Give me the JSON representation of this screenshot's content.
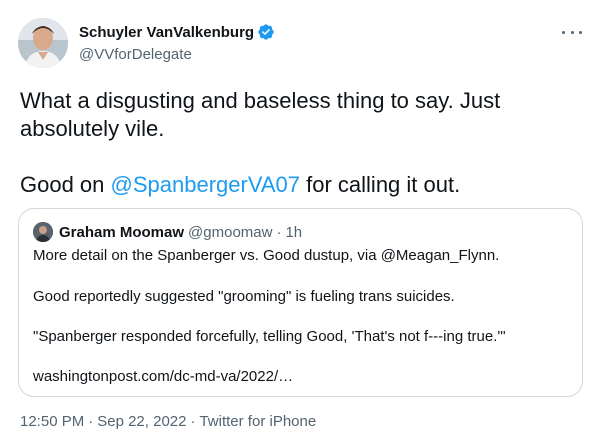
{
  "author": {
    "display_name": "Schuyler VanValkenburg",
    "handle": "@VVforDelegate",
    "verified": true,
    "verified_color": "#1d9bf0"
  },
  "more_icon": "more-dots-icon",
  "tweet": {
    "line1": "What a disgusting and baseless thing to say. Just absolutely vile.",
    "line2_prefix": "Good on ",
    "line2_mention": "@SpanbergerVA07",
    "line2_suffix": " for calling it out."
  },
  "quoted": {
    "display_name": "Graham Moomaw",
    "handle": "@gmoomaw",
    "separator": "·",
    "time": "1h",
    "lines": [
      "More detail on the Spanberger vs. Good dustup, via @Meagan_Flynn.",
      "Good reportedly suggested \"grooming\" is fueling trans suicides.",
      "\"Spanberger responded forcefully, telling Good, 'That's not f---ing true.'\"",
      "washingtonpost.com/dc-md-va/2022/…"
    ]
  },
  "footer": {
    "time": "12:50 PM",
    "sep1": "·",
    "date": "Sep 22, 2022",
    "sep2": "·",
    "source": "Twitter for iPhone"
  },
  "colors": {
    "text": "#0f1419",
    "secondary": "#536471",
    "link": "#1d9bf0",
    "border": "#cfd9de"
  }
}
